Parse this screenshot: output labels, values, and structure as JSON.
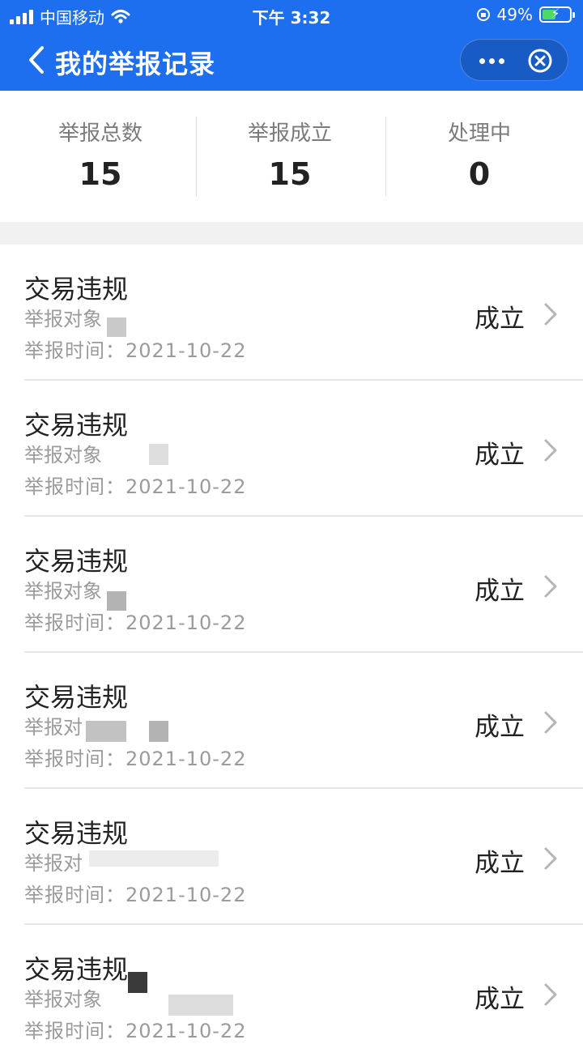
{
  "status_bar": {
    "carrier": "中国移动",
    "time": "下午 3:32",
    "battery": "49%",
    "battery_level": 0.49
  },
  "nav": {
    "title": "我的举报记录",
    "back_icon": "chevron-left-icon",
    "more_icon": "more-dots-icon",
    "close_icon": "close-circle-icon"
  },
  "stats": [
    {
      "label": "举报总数",
      "value": "15"
    },
    {
      "label": "举报成立",
      "value": "15"
    },
    {
      "label": "处理中",
      "value": "0"
    }
  ],
  "reports": [
    {
      "title": "交易违规",
      "target": "举报对象",
      "time": "举报时间：2021-10-22",
      "status": "成立"
    },
    {
      "title": "交易违规",
      "target": "举报对象",
      "time": "举报时间：2021-10-22",
      "status": "成立"
    },
    {
      "title": "交易违规",
      "target": "举报对象",
      "time": "举报时间：2021-10-22",
      "status": "成立"
    },
    {
      "title": "交易违规",
      "target": "举报对",
      "time": "举报时间：2021-10-22",
      "status": "成立"
    },
    {
      "title": "交易违规",
      "target": "举报对",
      "time": "举报时间：2021-10-22",
      "status": "成立"
    },
    {
      "title": "交易违规",
      "target": "举报对象",
      "time": "举报时间：2021-10-22",
      "status": "成立"
    }
  ],
  "colors": {
    "header_bg": "#1e6ff0",
    "battery_fill": "#4cd964",
    "muted_text": "#9b9b9b"
  }
}
